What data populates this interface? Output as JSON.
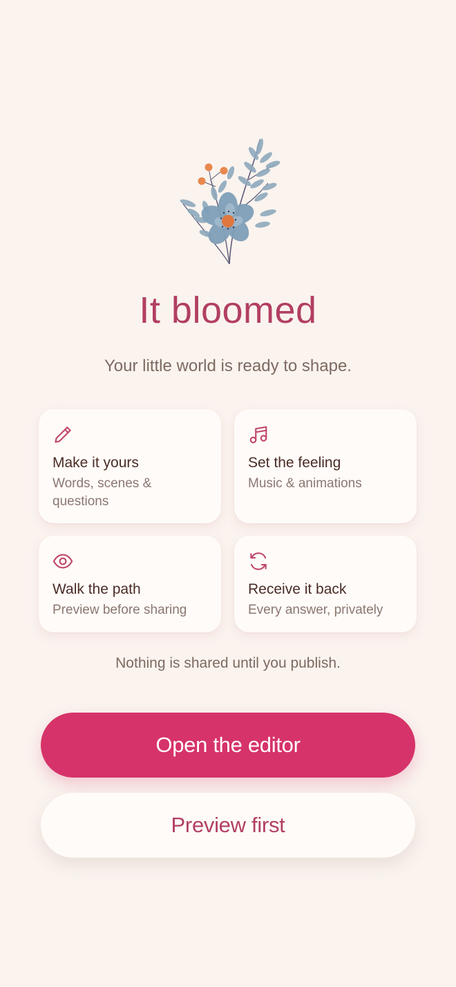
{
  "header": {
    "title": "It bloomed",
    "subtitle": "Your little world is ready to shape."
  },
  "features": [
    {
      "icon": "pencil-icon",
      "title": "Make it yours",
      "desc": "Words, scenes & questions"
    },
    {
      "icon": "music-note-icon",
      "title": "Set the feeling",
      "desc": "Music & animations"
    },
    {
      "icon": "eye-icon",
      "title": "Walk the path",
      "desc": "Preview before sharing"
    },
    {
      "icon": "refresh-icon",
      "title": "Receive it back",
      "desc": "Every answer, privately"
    }
  ],
  "note": "Nothing is shared until you publish.",
  "actions": {
    "primary_label": "Open the editor",
    "secondary_label": "Preview first"
  },
  "colors": {
    "background": "#faf3ee",
    "accent": "#d6336a",
    "title": "#b23f62"
  }
}
